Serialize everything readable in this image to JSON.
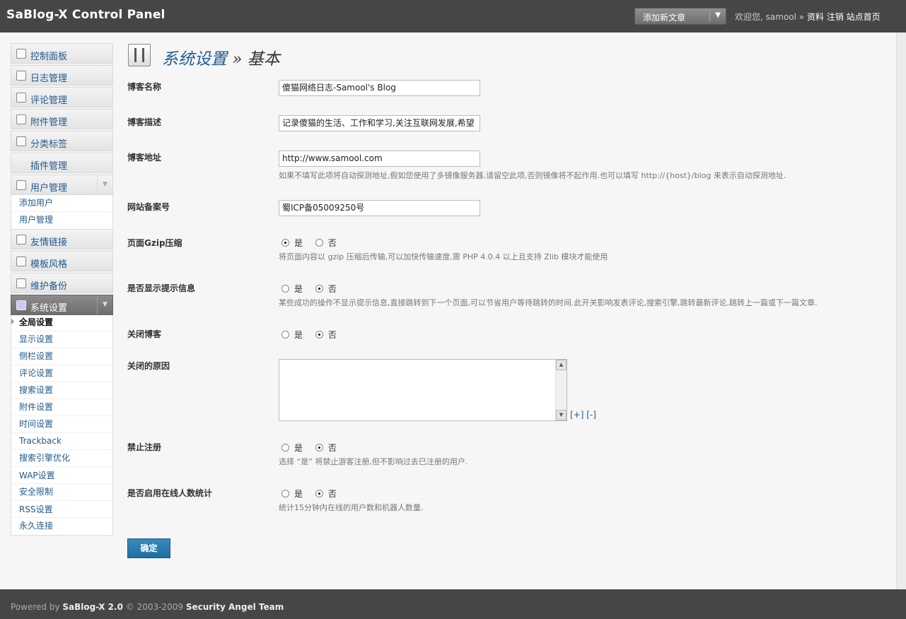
{
  "header": {
    "brand": "SaBlog-X Control Panel",
    "new_post_label": "添加新文章",
    "welcome_prefix": "欢迎您,",
    "username": "samool",
    "separator": "»",
    "profile_link": "资料",
    "logout_link": "注销",
    "home_link": "站点首页"
  },
  "sidebar": {
    "items": [
      {
        "label": "控制面板",
        "icon": "dashboard-icon"
      },
      {
        "label": "日志管理",
        "icon": "posts-icon"
      },
      {
        "label": "评论管理",
        "icon": "comments-icon"
      },
      {
        "label": "附件管理",
        "icon": "attachments-icon"
      },
      {
        "label": "分类标签",
        "icon": "pin-icon"
      },
      {
        "label": "插件管理",
        "icon": ""
      },
      {
        "label": "用户管理",
        "icon": "users-icon"
      },
      {
        "label": "友情链接",
        "icon": "link-icon"
      },
      {
        "label": "模板风格",
        "icon": "template-icon"
      },
      {
        "label": "维护备份",
        "icon": "tools-icon"
      },
      {
        "label": "系统设置",
        "icon": "settings-icon"
      }
    ],
    "user_sub": [
      "添加用户",
      "用户管理"
    ],
    "settings_sub": [
      "全局设置",
      "显示设置",
      "侧栏设置",
      "评论设置",
      "搜索设置",
      "附件设置",
      "时间设置",
      "Trackback",
      "搜索引擎优化",
      "WAP设置",
      "安全限制",
      "RSS设置",
      "永久连接"
    ]
  },
  "page": {
    "title": "系统设置",
    "separator": "»",
    "subtitle": "基本"
  },
  "form": {
    "blog_name_label": "博客名称",
    "blog_name_value": "傻猫网络日志-Samool's Blog",
    "blog_desc_label": "博客描述",
    "blog_desc_value": "记录傻猫的生活、工作和学习,关注互联网发展,希望",
    "blog_url_label": "博客地址",
    "blog_url_value": "http://www.samool.com",
    "blog_url_hint": "如果不填写此项将自动探测地址,假如您使用了多镜像服务器,请留空此项,否则镜像将不起作用.也可以填写  http://{host}/blog 来表示自动探测地址.",
    "icp_label": "网站备案号",
    "icp_value": "蜀ICP备05009250号",
    "gzip_label": "页面Gzip压缩",
    "gzip_hint": "将页面内容以  gzip 压缩后传输,可以加快传输速度,需  PHP 4.0.4 以上且支持  Zlib 模块才能使用",
    "show_msg_label": "是否显示提示信息",
    "show_msg_hint": "某些成功的操作不显示提示信息,直接跳转到下一个页面,可以节省用户等待跳转的时间.此开关影响发表评论,搜索引擎,跳转最新评论,跳转上一篇或下一篇文章.",
    "close_label": "关闭博客",
    "close_reason_label": "关闭的原因",
    "resize_plus": "[+]",
    "resize_minus": "[-]",
    "no_register_label": "禁止注册",
    "no_register_hint": "选择 “是” 将禁止游客注册,但不影响过去已注册的用户.",
    "online_label": "是否启用在线人数统计",
    "online_hint": "统计15分钟内在线的用户数和机器人数量.",
    "yes": "是",
    "no": "否",
    "submit_label": "确定"
  },
  "footer": {
    "powered_by": "Powered by",
    "product": "SaBlog-X 2.0",
    "copyright": "© 2003-2009",
    "team": "Security Angel Team"
  }
}
